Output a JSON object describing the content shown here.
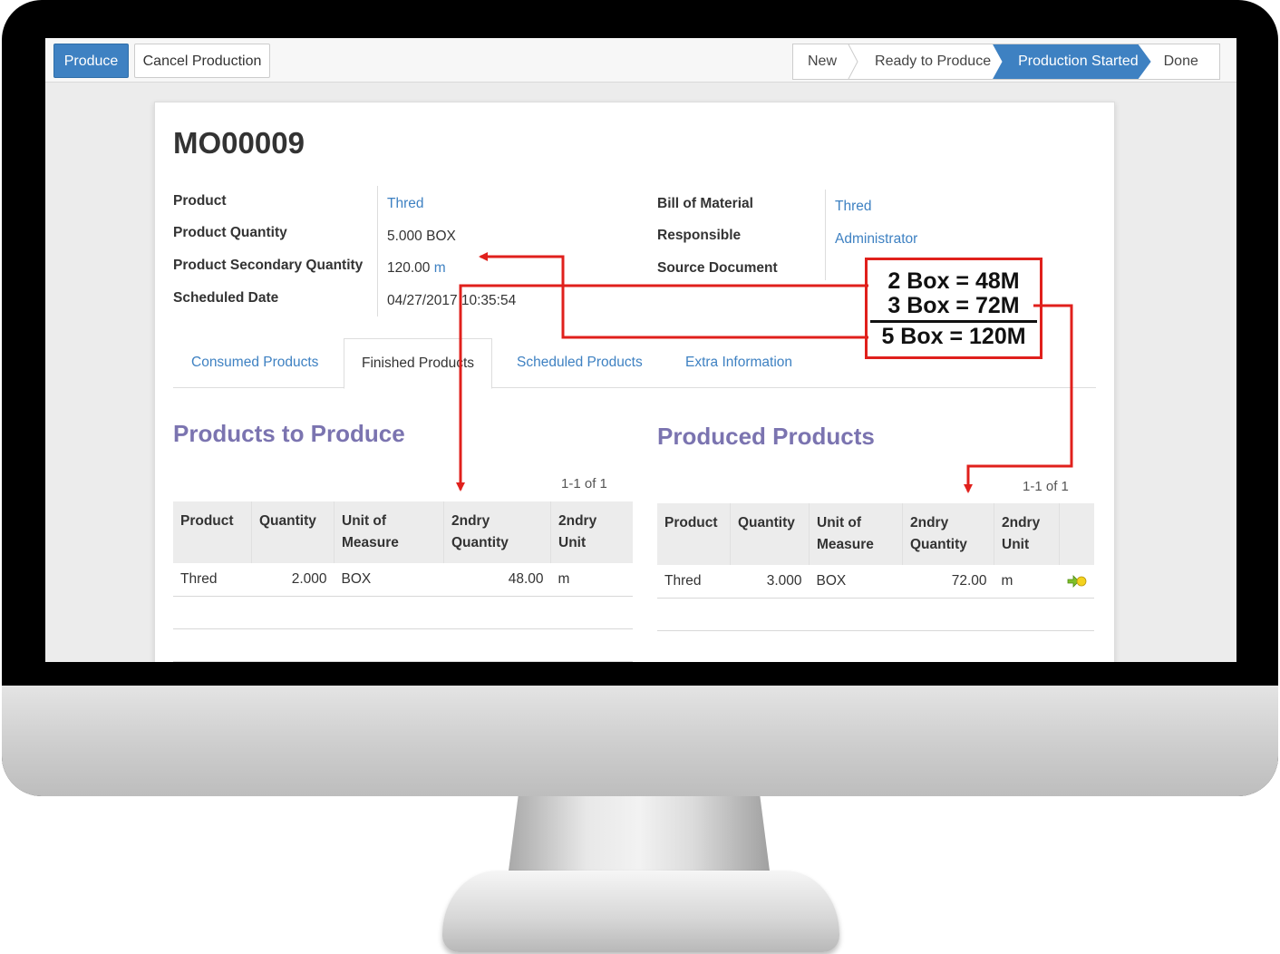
{
  "toolbar": {
    "produce_label": "Produce",
    "cancel_label": "Cancel Production",
    "states": [
      "New",
      "Ready to Produce",
      "Production Started",
      "Done"
    ],
    "active_state_index": 2
  },
  "record": {
    "title": "MO00009",
    "left_fields": [
      {
        "label": "Product",
        "value": "Thred"
      },
      {
        "label": "Product Quantity",
        "value": "5.000",
        "unit": "BOX"
      },
      {
        "label": "Product Secondary Quantity",
        "value": "120.00",
        "unit": "m"
      },
      {
        "label": "Scheduled Date",
        "value": "04/27/2017 10:35:54"
      }
    ],
    "right_fields": [
      {
        "label": "Bill of Material",
        "value": "Thred"
      },
      {
        "label": "Responsible",
        "value": "Administrator"
      },
      {
        "label": "Source Document",
        "value": ""
      }
    ]
  },
  "tabs": [
    "Consumed Products",
    "Finished Products",
    "Scheduled Products",
    "Extra Information"
  ],
  "active_tab_index": 1,
  "products_to_produce": {
    "title": "Products to Produce",
    "pager": "1-1 of 1",
    "columns": [
      "Product",
      "Quantity",
      "Unit of Measure",
      "2ndry Quantity",
      "2ndry Unit"
    ],
    "rows": [
      {
        "product": "Thred",
        "quantity": "2.000",
        "uom": "BOX",
        "qty2": "48.00",
        "unit2": "m"
      }
    ]
  },
  "produced_products": {
    "title": "Produced Products",
    "pager": "1-1 of 1",
    "columns": [
      "Product",
      "Quantity",
      "Unit of Measure",
      "2ndry Quantity",
      "2ndry Unit"
    ],
    "rows": [
      {
        "product": "Thred",
        "quantity": "3.000",
        "uom": "BOX",
        "qty2": "72.00",
        "unit2": "m"
      }
    ]
  },
  "annotation": {
    "line1": "2 Box = 48M",
    "line2": "3 Box = 72M",
    "total": "5 Box = 120M",
    "color": "#e0201c"
  },
  "colors": {
    "primary": "#3e81c2",
    "section_title": "#7b74b0"
  }
}
